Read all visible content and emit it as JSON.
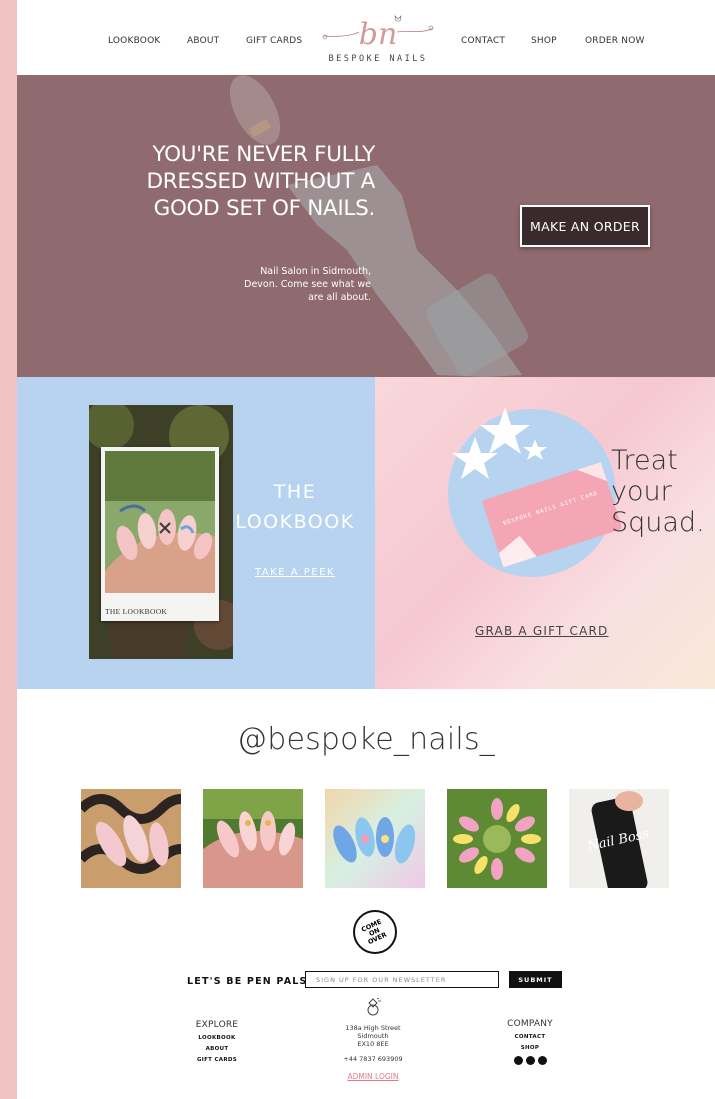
{
  "nav": {
    "left": [
      "LOOKBOOK",
      "ABOUT",
      "GIFT CARDS"
    ],
    "right": [
      "CONTACT",
      "SHOP",
      "ORDER NOW"
    ],
    "logo_text": "BESPOKE NAILS",
    "logo_monogram": "bn"
  },
  "hero": {
    "title": "YOU'RE NEVER FULLY DRESSED WITHOUT A GOOD SET OF NAILS.",
    "subtitle": "Nail Salon in Sidmouth, Devon. Come see what we are all about.",
    "button": "MAKE AN ORDER"
  },
  "lookbook": {
    "caption": "THE LOOKBOOK",
    "title": "THE LOOKBOOK",
    "link": "TAKE A PEEK"
  },
  "gift": {
    "card_text": "BESPOKE NAILS GIFT CARD",
    "heading": "Treat your Squad.",
    "link": "GRAB A GIFT CARD"
  },
  "instagram": {
    "handle": "@bespoke_nails_",
    "images": [
      "nails-photo-1",
      "nails-photo-2",
      "nails-photo-3",
      "nails-photo-4",
      "nail-boss-bottle-photo"
    ],
    "bottle_text": "Nail Boss"
  },
  "badge": {
    "text": "COME\nON\nOVER"
  },
  "newsletter": {
    "label": "LET'S BE PEN PALS",
    "placeholder": "SIGN UP FOR OUR NEWSLETTER",
    "button": "SUBMIT"
  },
  "footer": {
    "explore": {
      "heading": "EXPLORE",
      "links": [
        "LOOKBOOK",
        "ABOUT",
        "GIFT CARDS"
      ]
    },
    "address": [
      "138a High Street",
      "Sidmouth",
      "EX10 8EE"
    ],
    "phone": "+44 7837 693909",
    "admin": "ADMIN LOGIN",
    "company": {
      "heading": "COMPANY",
      "links": [
        "CONTACT",
        "SHOP"
      ]
    },
    "social_icons": [
      "instagram-icon",
      "twitter-icon",
      "facebook-icon"
    ]
  },
  "colors": {
    "page_bg": "#f1c3c3",
    "hero_bg": "#8f6a6f",
    "lookbook_bg": "#b7d3ef",
    "accent_pink": "#e27a8b",
    "dark": "#3b2a2d"
  }
}
